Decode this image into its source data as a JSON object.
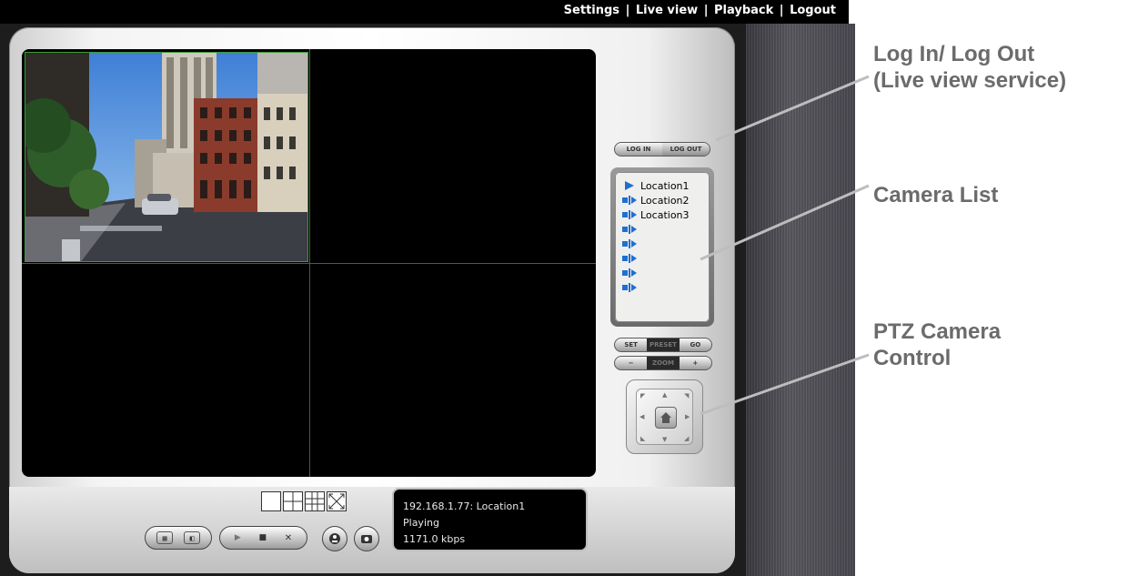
{
  "topnav": {
    "settings": "Settings",
    "live_view": "Live view",
    "playback": "Playback",
    "logout": "Logout",
    "separator": "|"
  },
  "login_toggle": {
    "log_in": "LOG IN",
    "log_out": "LOG OUT"
  },
  "camera_list": {
    "items": [
      {
        "label": "Location1",
        "icon": "play-arrow-icon",
        "active": true
      },
      {
        "label": "Location2",
        "icon": "camera-icon"
      },
      {
        "label": "Location3",
        "icon": "camera-icon"
      },
      {
        "label": "",
        "icon": "camera-icon"
      },
      {
        "label": "",
        "icon": "camera-icon"
      },
      {
        "label": "",
        "icon": "camera-icon"
      },
      {
        "label": "",
        "icon": "camera-icon"
      },
      {
        "label": "",
        "icon": "camera-icon"
      }
    ]
  },
  "preset": {
    "set": "SET",
    "label": "PRESET",
    "go": "GO"
  },
  "zoom": {
    "minus": "−",
    "label": "ZOOM",
    "plus": "+"
  },
  "status": {
    "source": "192.168.1.77: Location1",
    "state": "Playing",
    "bitrate": "1171.0 kbps"
  },
  "callouts": {
    "login_line1": "Log In/ Log Out",
    "login_line2": "(Live view service)",
    "camera_list": "Camera List",
    "ptz_line1": "PTZ Camera",
    "ptz_line2": "Control"
  },
  "colors": {
    "callout_text": "#6b6b6b",
    "active_feed_border": "#3c9a3c",
    "camera_icon": "#1f6fd1"
  }
}
